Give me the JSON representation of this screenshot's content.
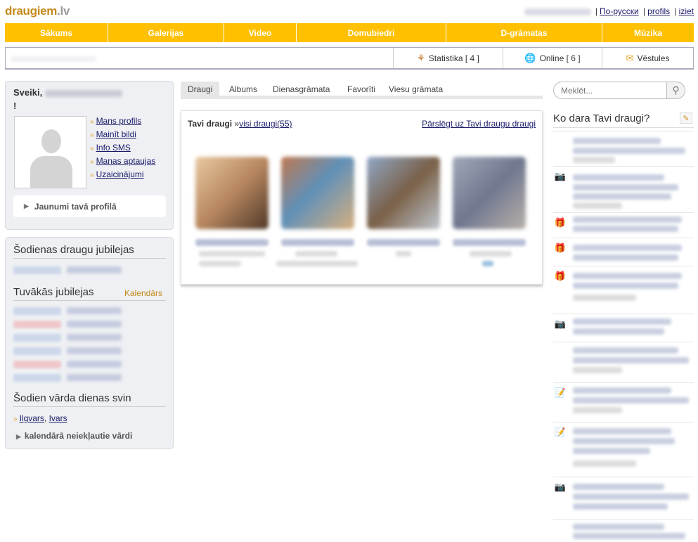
{
  "header": {
    "logo": "draugiem",
    "logo_tld": ".lv",
    "links": [
      "По-русски",
      "profils",
      "iziet"
    ]
  },
  "nav": [
    "Sākums",
    "Galerijas",
    "Video",
    "Domubiedri",
    "D-grāmatas",
    "Mūzika"
  ],
  "subbar": {
    "statistika": "Statistika [ 4 ]",
    "online": "Online [ 6 ]",
    "vestules": "Vēstules"
  },
  "profile": {
    "greeting": "Sveiki,",
    "exclaim": "!",
    "links": [
      "Mans profils",
      "Mainīt bildi",
      "Info SMS",
      "Manas aptaujas",
      "Uzaicinājumi"
    ],
    "news_button": "Jaunumi tavā profilā"
  },
  "birthdays": {
    "today_title": "Šodienas draugu jubilejas",
    "upcoming_title": "Tuvākās jubilejas",
    "calendar_link": "Kalendārs",
    "nameday_title": "Šodien vārda dienas svin",
    "nameday_names": [
      "Ilgvars",
      "Ivars"
    ],
    "nameday_sep": ", ",
    "unlisted": "kalendārā neiekļautie vārdi"
  },
  "tabs": [
    "Draugi",
    "Albums",
    "Dienasgrāmata",
    "Favorīti",
    "Viesu grāmata"
  ],
  "friends": {
    "title": "Tavi draugi",
    "sep": " »",
    "all_link": "visi draugi(55)",
    "switch_link": "Pārslēgt uz Tavi draugu draugi"
  },
  "search": {
    "placeholder": "Meklēt..."
  },
  "activity": {
    "title": "Ko dara Tavi draugi?"
  },
  "colors": {
    "nav_bg": "#ffc000",
    "logo": "#c48a1c",
    "link": "#1a1a6a",
    "panel_bg": "#eef0f3"
  }
}
